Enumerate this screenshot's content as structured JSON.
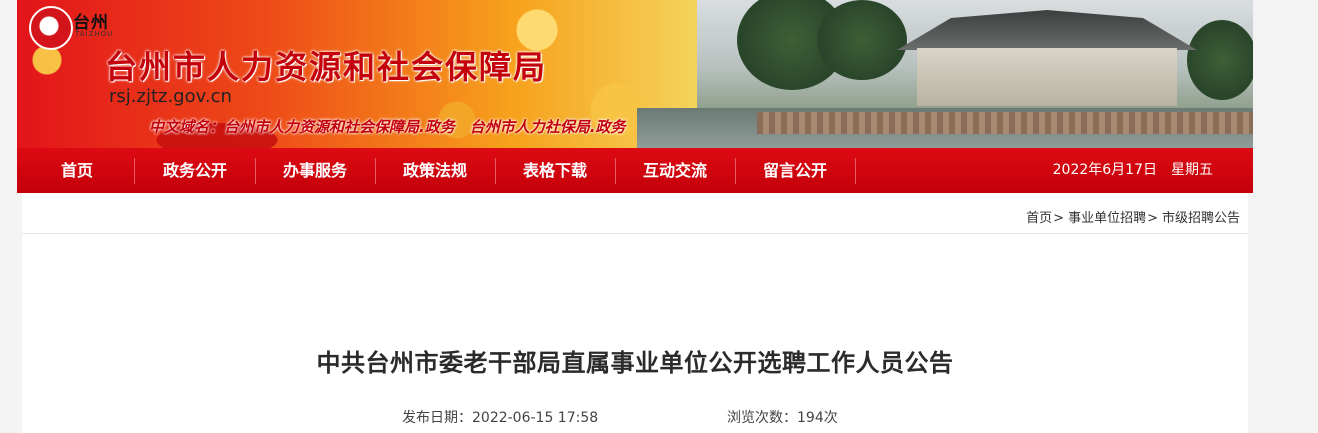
{
  "header": {
    "logo_text": "台州",
    "logo_sub": "TAIZHOU",
    "site_title": "台州市人力资源和社会保障局",
    "domain": "rsj.zjtz.gov.cn",
    "cn_domain": "中文域名：台州市人力资源和社会保障局.政务　台州市人力社保局.政务"
  },
  "nav": {
    "items": [
      {
        "label": "首页"
      },
      {
        "label": "政务公开"
      },
      {
        "label": "办事服务"
      },
      {
        "label": "政策法规"
      },
      {
        "label": "表格下载"
      },
      {
        "label": "互动交流"
      },
      {
        "label": "留言公开"
      }
    ],
    "date": "2022年6月17日",
    "weekday": "星期五"
  },
  "breadcrumb": {
    "items": [
      "首页",
      "事业单位招聘",
      "市级招聘公告"
    ],
    "separator": ">"
  },
  "article": {
    "title": "中共台州市委老干部局直属事业单位公开选聘工作人员公告",
    "publish_label": "发布日期：",
    "publish_date": "2022-06-15 17:58",
    "views_label": "浏览次数：",
    "views": "194次"
  },
  "colors": {
    "brand_red": "#c4000b",
    "nav_red": "#dd0a12",
    "page_bg": "#f3f3f3"
  }
}
